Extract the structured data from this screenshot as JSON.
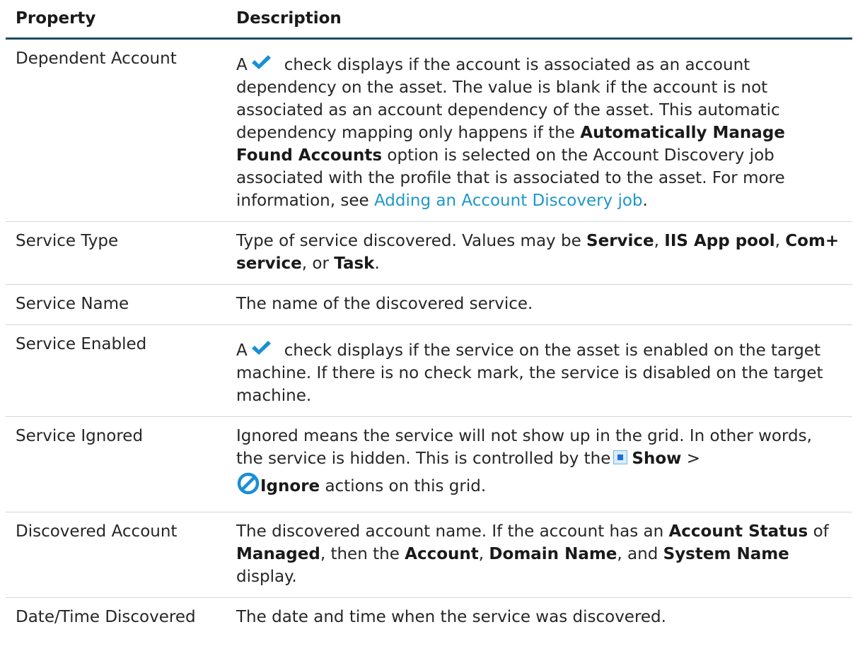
{
  "table": {
    "header": {
      "property": "Property",
      "description": "Description"
    },
    "rows": [
      {
        "property": "Dependent Account",
        "description": {
          "a": "A",
          "t1": "check displays if the account is associated as an account dependency on the asset. The value is blank if the account is not associated as an account dependency of the asset. This automatic dependency mapping only happens if the",
          "b1": "Automatically Manage Found Accounts",
          "t2": "option is selected on the Account Discovery job associated with the profile that is associated to the asset. For more information, see",
          "link": "Adding an Account Discovery job",
          "t3": "."
        }
      },
      {
        "property": "Service Type",
        "description": {
          "t1": "Type of service discovered. Values may be",
          "b1": "Service",
          "t2": ",",
          "b2": "IIS App pool",
          "t3": ",",
          "b3": "Com+ service",
          "t4": ", or",
          "b4": "Task",
          "t5": "."
        }
      },
      {
        "property": "Service Name",
        "description": {
          "t1": "The name of the discovered service."
        }
      },
      {
        "property": "Service Enabled",
        "description": {
          "a": "A",
          "t1": "check displays if the service on the asset is enabled on the target machine. If there is no check mark, the service is disabled on the target machine."
        }
      },
      {
        "property": "Service Ignored",
        "description": {
          "t1": "Ignored means the service will not show up in the grid. In other words, the service is hidden. This is controlled by the",
          "b1": "Show",
          "t2": ">",
          "b2": "Ignore",
          "t3": "actions on this grid."
        }
      },
      {
        "property": "Discovered Account",
        "description": {
          "t1": "The discovered account name. If the account has an",
          "b1": "Account Status",
          "t2": "of",
          "b2": "Managed",
          "t3": ", then the",
          "b3": "Account",
          "t4": ",",
          "b4": "Domain Name",
          "t5": ", and",
          "b5": "System Name",
          "t6": "display."
        }
      },
      {
        "property": "Date/Time Discovered",
        "description": {
          "t1": "The date and time when the service was discovered."
        }
      }
    ]
  },
  "icons": {
    "check": "check-icon",
    "show": "show-icon",
    "ignore": "ignore-icon"
  },
  "colors": {
    "header_rule": "#1d4f5f",
    "link": "#1e98c9",
    "check": "#1a8fd6",
    "show_border": "#6fb8e8",
    "show_fill": "#1a6fd1",
    "ignore": "#1a8fd6"
  }
}
